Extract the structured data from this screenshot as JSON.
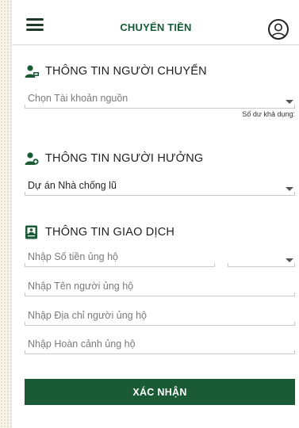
{
  "header": {
    "title": "CHUYỂN TIỀN"
  },
  "sender_section": {
    "heading": "THÔNG TIN NGƯỜI CHUYỂN",
    "account_placeholder": "Chọn Tài khoản nguồn",
    "balance_label": "Số dư khả dụng:"
  },
  "beneficiary_section": {
    "heading": "THÔNG TIN NGƯỜI HƯỞNG",
    "selected_beneficiary": "Dự án Nhà chống lũ"
  },
  "transaction_section": {
    "heading": "THÔNG TIN GIAO DỊCH",
    "amount_placeholder": "Nhập Số tiền ủng hộ",
    "donor_name_placeholder": "Nhập Tên người ủng hộ",
    "donor_address_placeholder": "Nhập Địa chỉ người ủng hộ",
    "donor_circumstance_placeholder": "Nhập Hoàn cảnh ủng hộ"
  },
  "actions": {
    "confirm_label": "XÁC NHẬN"
  },
  "colors": {
    "brand_green": "#1a5a34",
    "title_green": "#165b36"
  },
  "icons": [
    "menu-icon",
    "user-avatar-icon",
    "person-icon",
    "person-add-icon",
    "document-icon",
    "chevron-down-icon"
  ]
}
